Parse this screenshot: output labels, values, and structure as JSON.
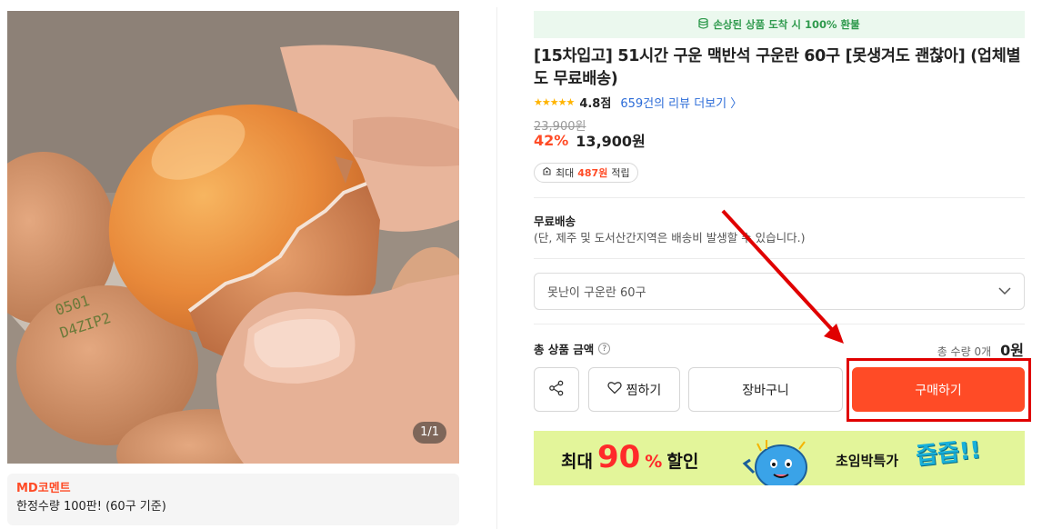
{
  "gallery": {
    "counter": "1/1",
    "md_title": "MD코멘트",
    "md_text": "한정수량 100판! (60구 기준)"
  },
  "product": {
    "refund_notice": "손상된 상품 도착 시 100% 환불",
    "title": "[15차입고] 51시간 구운 맥반석 구운란 60구 [못생겨도 괜찮아] (업체별도 무료배송)",
    "stars": "★★★★★",
    "rating": "4.8점",
    "review_link": "659건의 리뷰 더보기 〉",
    "original_price": "23,900원",
    "discount": "42%",
    "price": "13,900원",
    "points_prefix": "최대",
    "points_amount": "487원",
    "points_suffix": "적립"
  },
  "shipping": {
    "title": "무료배송",
    "note": "(단, 제주 및 도서산간지역은 배송비 발생할 수 있습니다.)"
  },
  "option": {
    "selected": "못난이 구운란 60구"
  },
  "total": {
    "label": "총 상품 금액",
    "qty": "총 수량 0개",
    "amount": "0원"
  },
  "buttons": {
    "wish": "찜하기",
    "cart": "장바구니",
    "buy": "구매하기"
  },
  "banner": {
    "prefix": "최대",
    "percent_number": "90",
    "percent_sign": "%",
    "suffix": "할인",
    "right_text": "초임박특가",
    "right_emphasis": "즙즙!!"
  },
  "colors": {
    "accent": "#ff4b26",
    "link": "#2c6cd8",
    "refund_green": "#2f9a4d",
    "annotation_red": "#e00000"
  }
}
